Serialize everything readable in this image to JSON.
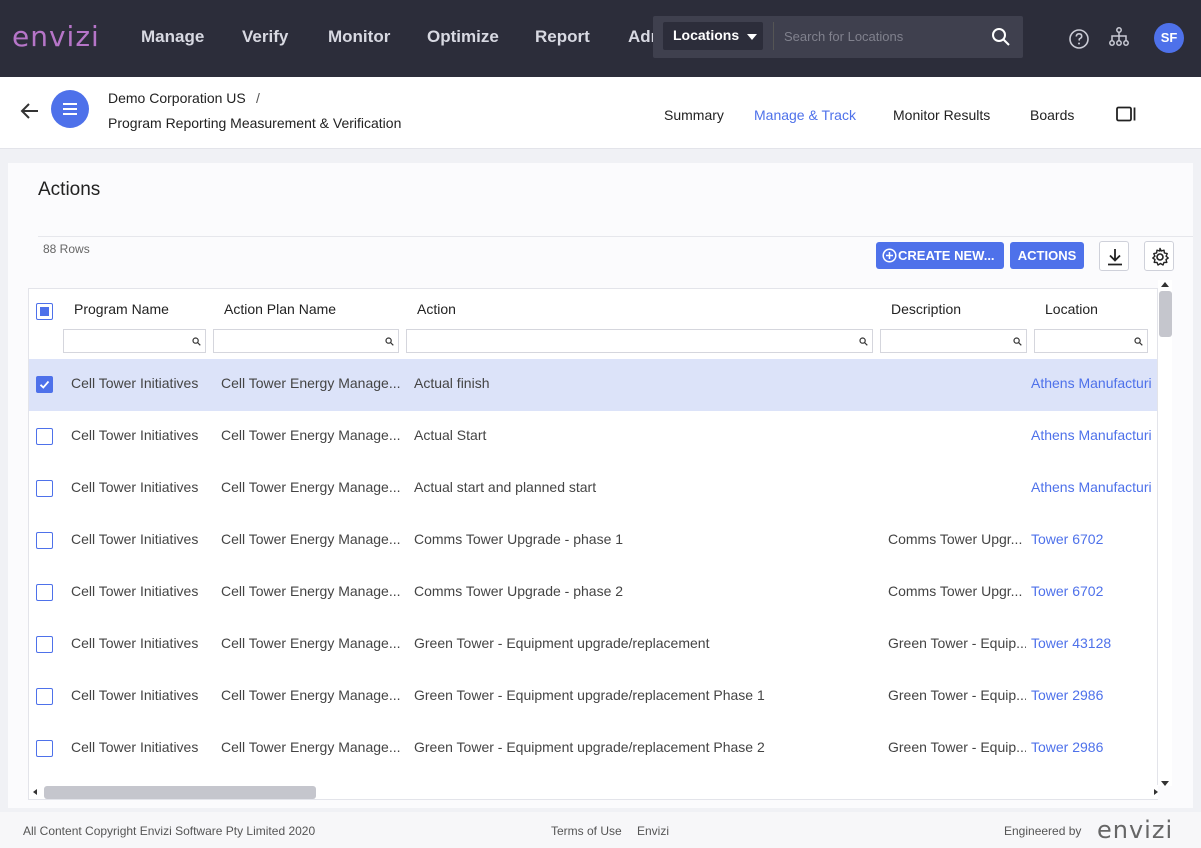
{
  "app": {
    "logo": "envizi",
    "nav": [
      "Manage",
      "Verify",
      "Monitor",
      "Optimize",
      "Report",
      "Adr"
    ],
    "search": {
      "scope": "Locations",
      "placeholder": "Search for Locations"
    },
    "user_initials": "SF",
    "accent": "#4e71ea"
  },
  "header": {
    "breadcrumb_1": "Demo Corporation US",
    "breadcrumb_sep": "/",
    "breadcrumb_2": "Program Reporting Measurement & Verification",
    "tabs": [
      "Summary",
      "Manage & Track",
      "Monitor Results",
      "Boards"
    ],
    "active_tab": "Manage & Track"
  },
  "page": {
    "title": "Actions",
    "rows_count": "88 Rows",
    "create_label": "CREATE NEW...",
    "actions_label": "ACTIONS"
  },
  "table": {
    "columns": [
      "Program Name",
      "Action Plan Name",
      "Action",
      "Description",
      "Location"
    ],
    "rows": [
      {
        "checked": true,
        "program": "Cell Tower Initiatives",
        "plan": "Cell Tower Energy Manage...",
        "action": "Actual finish",
        "description": "",
        "location": "Athens Manufacturi"
      },
      {
        "checked": false,
        "program": "Cell Tower Initiatives",
        "plan": "Cell Tower Energy Manage...",
        "action": "Actual Start",
        "description": "",
        "location": "Athens Manufacturi"
      },
      {
        "checked": false,
        "program": "Cell Tower Initiatives",
        "plan": "Cell Tower Energy Manage...",
        "action": "Actual start and planned start",
        "description": "",
        "location": "Athens Manufacturi"
      },
      {
        "checked": false,
        "program": "Cell Tower Initiatives",
        "plan": "Cell Tower Energy Manage...",
        "action": "Comms Tower Upgrade - phase 1",
        "description": "Comms Tower Upgr...",
        "location": "Tower 6702"
      },
      {
        "checked": false,
        "program": "Cell Tower Initiatives",
        "plan": "Cell Tower Energy Manage...",
        "action": "Comms Tower Upgrade - phase 2",
        "description": "Comms Tower Upgr...",
        "location": "Tower 6702"
      },
      {
        "checked": false,
        "program": "Cell Tower Initiatives",
        "plan": "Cell Tower Energy Manage...",
        "action": "Green Tower - Equipment upgrade/replacement",
        "description": "Green Tower - Equip...",
        "location": "Tower 43128"
      },
      {
        "checked": false,
        "program": "Cell Tower Initiatives",
        "plan": "Cell Tower Energy Manage...",
        "action": "Green Tower - Equipment upgrade/replacement Phase 1",
        "description": "Green Tower - Equip...",
        "location": "Tower 2986"
      },
      {
        "checked": false,
        "program": "Cell Tower Initiatives",
        "plan": "Cell Tower Energy Manage...",
        "action": "Green Tower - Equipment upgrade/replacement Phase 2",
        "description": "Green Tower - Equip...",
        "location": "Tower 2986"
      }
    ]
  },
  "footer": {
    "copyright": "All Content Copyright Envizi Software Pty Limited 2020",
    "terms": "Terms of Use",
    "envizi_link": "Envizi",
    "engineered_by": "Engineered by",
    "logo": "envizi"
  }
}
